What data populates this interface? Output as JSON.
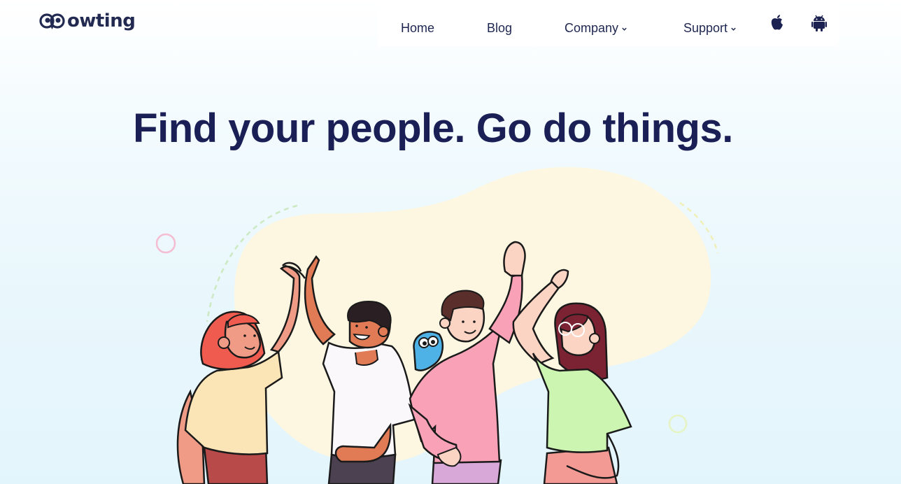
{
  "brand": {
    "name": "owting",
    "logo_icon": "owl-eyes-icon"
  },
  "nav": {
    "items": [
      {
        "label": "Home"
      },
      {
        "label": "Blog"
      },
      {
        "label": "Company",
        "icon": "chevron-down-icon"
      },
      {
        "label": "Support",
        "icon": "chevron-down-icon"
      }
    ],
    "store_icons": [
      "apple-icon",
      "android-icon"
    ]
  },
  "hero": {
    "title": "Find your people. Go do things."
  },
  "colors": {
    "navy": "#1b2150",
    "blob": "#fdf7e2",
    "bg": "#e6f6fc"
  }
}
